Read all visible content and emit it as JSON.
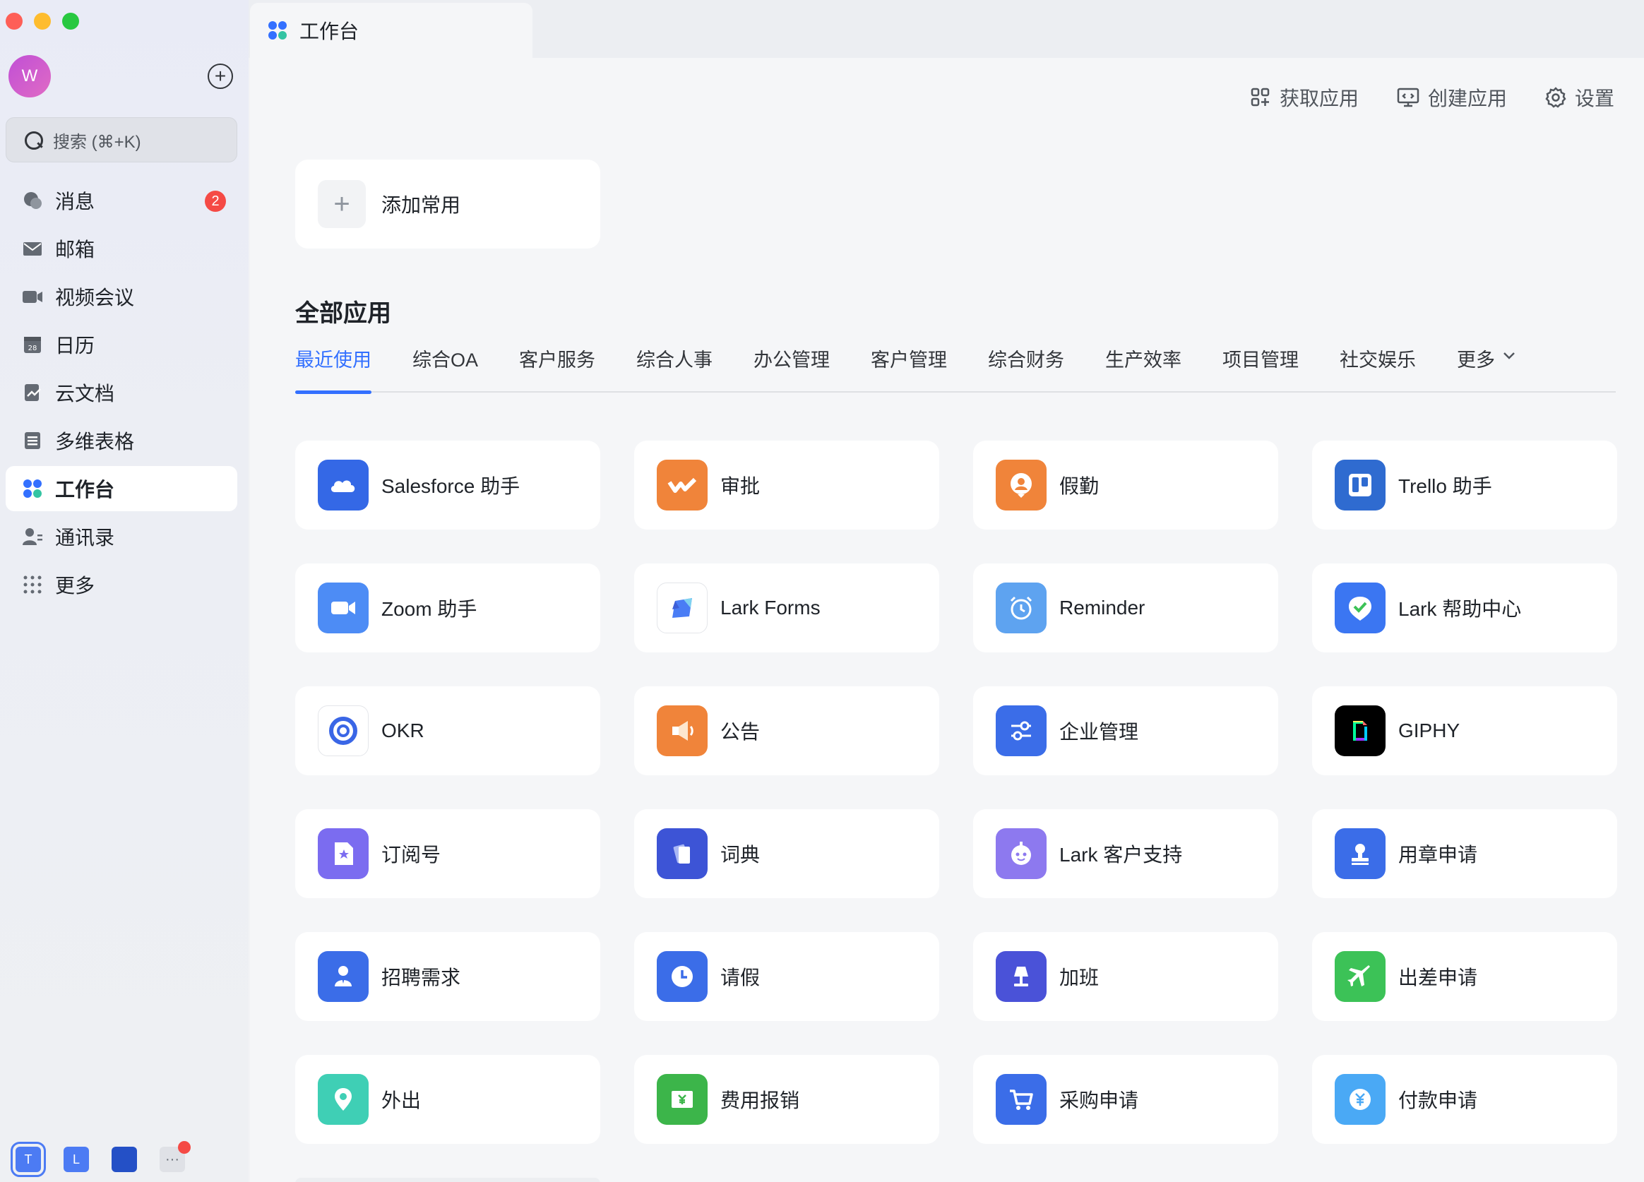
{
  "sidebar": {
    "avatar_letter": "W",
    "search_placeholder": "搜索 (⌘+K)",
    "items": [
      {
        "label": "消息",
        "icon": "chat-bubble-icon",
        "badge": "2"
      },
      {
        "label": "邮箱",
        "icon": "mail-icon"
      },
      {
        "label": "视频会议",
        "icon": "video-camera-icon"
      },
      {
        "label": "日历",
        "icon": "calendar-icon",
        "icon_text": "28"
      },
      {
        "label": "云文档",
        "icon": "cloud-doc-icon"
      },
      {
        "label": "多维表格",
        "icon": "table-icon"
      },
      {
        "label": "工作台",
        "icon": "workplace-icon",
        "active": true
      },
      {
        "label": "通讯录",
        "icon": "contacts-icon"
      },
      {
        "label": "更多",
        "icon": "more-grid-icon"
      }
    ],
    "bottom_tenants": [
      "T",
      "L",
      "",
      "···"
    ]
  },
  "tab": {
    "label": "工作台"
  },
  "toolbar": {
    "get_apps": "获取应用",
    "create_app": "创建应用",
    "settings": "设置"
  },
  "add_favorite": "添加常用",
  "section_title": "全部应用",
  "categories": [
    "最近使用",
    "综合OA",
    "客户服务",
    "综合人事",
    "办公管理",
    "客户管理",
    "综合财务",
    "生产效率",
    "项目管理",
    "社交娱乐",
    "更多"
  ],
  "apps": [
    {
      "name": "Salesforce 助手",
      "icon": "salesforce-cloud-icon",
      "color": "#3468e6"
    },
    {
      "name": "审批",
      "icon": "approval-icon",
      "color": "#f0843a"
    },
    {
      "name": "假勤",
      "icon": "attendance-icon",
      "color": "#f0843a"
    },
    {
      "name": "Trello 助手",
      "icon": "trello-icon",
      "color": "#2f6bd0"
    },
    {
      "name": "Zoom 助手",
      "icon": "zoom-video-icon",
      "color": "#4d8cf5"
    },
    {
      "name": "Lark Forms",
      "icon": "forms-icon",
      "color": "#ffffff"
    },
    {
      "name": "Reminder",
      "icon": "alarm-clock-icon",
      "color": "#5ea3f0"
    },
    {
      "name": "Lark 帮助中心",
      "icon": "help-center-icon",
      "color": "#3b76f2"
    },
    {
      "name": "OKR",
      "icon": "okr-target-icon",
      "color": "#ffffff"
    },
    {
      "name": "公告",
      "icon": "megaphone-icon",
      "color": "#f0843a"
    },
    {
      "name": "企业管理",
      "icon": "sliders-icon",
      "color": "#3b6de8"
    },
    {
      "name": "GIPHY",
      "icon": "giphy-icon",
      "color": "#000000"
    },
    {
      "name": "订阅号",
      "icon": "subscription-icon",
      "color": "#7b6cf0"
    },
    {
      "name": "词典",
      "icon": "dictionary-icon",
      "color": "#3d54d6"
    },
    {
      "name": "Lark 客户支持",
      "icon": "support-bot-icon",
      "color": "#8d79ef"
    },
    {
      "name": "用章申请",
      "icon": "seal-stamp-icon",
      "color": "#3b6de8"
    },
    {
      "name": "招聘需求",
      "icon": "recruit-person-icon",
      "color": "#3b6de8"
    },
    {
      "name": "请假",
      "icon": "leave-clock-icon",
      "color": "#3b6de8"
    },
    {
      "name": "加班",
      "icon": "overtime-lamp-icon",
      "color": "#4a52d8"
    },
    {
      "name": "出差申请",
      "icon": "airplane-icon",
      "color": "#3cc257"
    },
    {
      "name": "外出",
      "icon": "location-pin-icon",
      "color": "#3fcfb5"
    },
    {
      "name": "费用报销",
      "icon": "reimburse-icon",
      "color": "#3cb54a"
    },
    {
      "name": "采购申请",
      "icon": "shopping-cart-icon",
      "color": "#3b6de8"
    },
    {
      "name": "付款申请",
      "icon": "payment-icon",
      "color": "#4aa9f5"
    }
  ],
  "colors": {
    "accent": "#3370ff",
    "badge": "#f54a45"
  }
}
